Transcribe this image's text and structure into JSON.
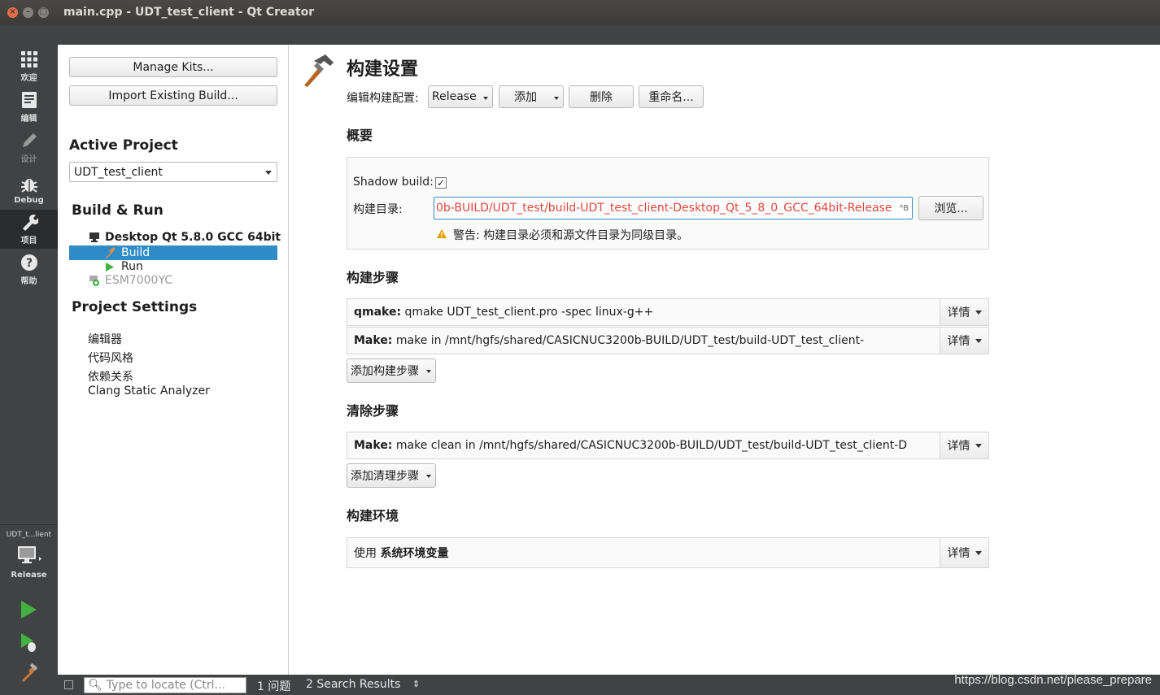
{
  "window": {
    "title": "main.cpp - UDT_test_client - Qt Creator"
  },
  "modebar": {
    "items": [
      {
        "label": "欢迎",
        "icon": "grid-icon"
      },
      {
        "label": "编辑",
        "icon": "document-icon"
      },
      {
        "label": "设计",
        "icon": "pencil-icon"
      },
      {
        "label": "Debug",
        "icon": "bug-icon"
      },
      {
        "label": "项目",
        "icon": "wrench-icon"
      },
      {
        "label": "帮助",
        "icon": "help-icon"
      }
    ],
    "kit_label": "UDT_t...lient",
    "target_label": "Release"
  },
  "left": {
    "manage_kits": "Manage Kits...",
    "import_build": "Import Existing Build...",
    "active_project_heading": "Active Project",
    "active_project": "UDT_test_client",
    "build_run_heading": "Build & Run",
    "kit": "Desktop Qt 5.8.0 GCC 64bit",
    "build": "Build",
    "run": "Run",
    "other_kit": "ESM7000YC",
    "project_settings_heading": "Project Settings",
    "settings": [
      "编辑器",
      "代码风格",
      "依赖关系",
      "Clang Static Analyzer"
    ]
  },
  "content": {
    "title": "构建设置",
    "edit_config_label": "编辑构建配置:",
    "config_value": "Release",
    "add": "添加",
    "delete": "删除",
    "rename": "重命名...",
    "general_heading": "概要",
    "shadow_build_label": "Shadow build:",
    "shadow_build_checked": true,
    "build_dir_label": "构建目录:",
    "build_dir_value": "0b-BUILD/UDT_test/build-UDT_test_client-Desktop_Qt_5_8_0_GCC_64bit-Release",
    "browse": "浏览...",
    "warning": "警告: 构建目录必须和源文件目录为同级目录。",
    "build_steps_heading": "构建步骤",
    "qmake_bold": "qmake:",
    "qmake_text": " qmake UDT_test_client.pro -spec linux-g++",
    "make_bold": "Make:",
    "make_text": " make in /mnt/hgfs/shared/CASICNUC3200b-BUILD/UDT_test/build-UDT_test_client-",
    "details": "详情",
    "add_build_step": "添加构建步骤",
    "clean_steps_heading": "清除步骤",
    "clean_bold": "Make:",
    "clean_text": " make clean in /mnt/hgfs/shared/CASICNUC3200b-BUILD/UDT_test/build-UDT_test_client-D",
    "add_clean_step": "添加清理步骤",
    "env_heading": "构建环境",
    "env_prefix": "使用 ",
    "env_bold": "系统环境变量"
  },
  "statusbar": {
    "locator_placeholder": "Type to locate (Ctrl...",
    "issues": "1  问题",
    "search": "2  Search Results"
  },
  "watermark": "https://blog.csdn.net/please_prepare",
  "colors": {
    "accent": "#308cc6",
    "warning": "#e0a000",
    "path_red": "#e0473b",
    "run_green": "#41b241"
  }
}
